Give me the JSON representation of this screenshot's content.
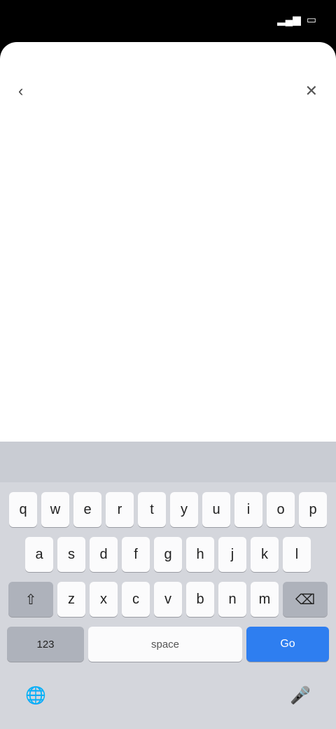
{
  "status": {
    "time": "",
    "signal_icon": "signal-icon",
    "battery_icon": "battery-icon"
  },
  "header": {
    "link_label": ""
  },
  "list": [
    {
      "title": "",
      "subtitle": ""
    },
    {
      "title": "",
      "subtitle": ""
    },
    {
      "title": "",
      "subtitle": ""
    },
    {
      "title": "",
      "subtitle": ""
    },
    {
      "title": "",
      "subtitle": ""
    }
  ],
  "more_label": "",
  "keyboard": {
    "suggestion": "",
    "row1": [
      "q",
      "w",
      "e",
      "r",
      "t",
      "y",
      "u",
      "i",
      "o",
      "p"
    ],
    "row2": [
      "a",
      "s",
      "d",
      "f",
      "g",
      "h",
      "j",
      "k",
      "l"
    ],
    "row3": [
      "z",
      "x",
      "c",
      "v",
      "b",
      "n",
      "m"
    ],
    "shift": "⇧",
    "backspace": "⌫",
    "numbers": "123",
    "space": "space",
    "go": "Go",
    "globe": "🌐",
    "mic": "🎤"
  }
}
